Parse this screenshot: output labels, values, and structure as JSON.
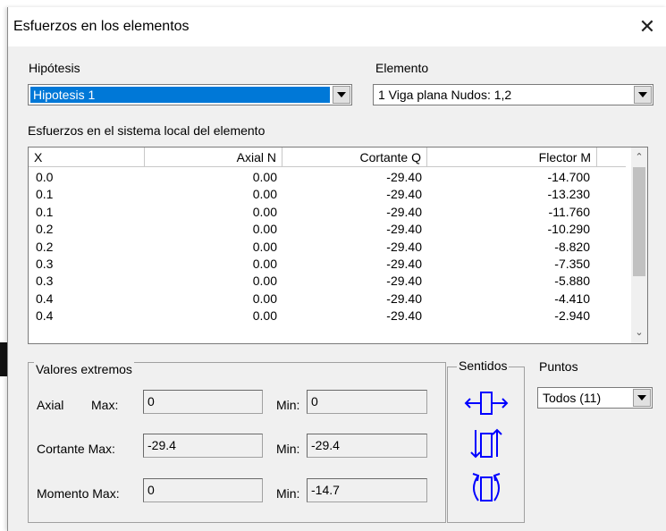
{
  "window": {
    "title": "Esfuerzos en los elementos",
    "close_glyph": "✕"
  },
  "hipotesis": {
    "label": "Hipótesis",
    "value": "Hipotesis 1"
  },
  "elemento": {
    "label": "Elemento",
    "value": "1  Viga plana  Nudos: 1,2"
  },
  "table_caption": "Esfuerzos en el sistema local del elemento",
  "table": {
    "headers": [
      "X",
      "Axial N",
      "Cortante Q",
      "Flector M"
    ],
    "rows": [
      [
        "0.0",
        "0.00",
        "-29.40",
        "-14.700"
      ],
      [
        "0.1",
        "0.00",
        "-29.40",
        "-13.230"
      ],
      [
        "0.1",
        "0.00",
        "-29.40",
        "-11.760"
      ],
      [
        "0.2",
        "0.00",
        "-29.40",
        "-10.290"
      ],
      [
        "0.2",
        "0.00",
        "-29.40",
        "-8.820"
      ],
      [
        "0.3",
        "0.00",
        "-29.40",
        "-7.350"
      ],
      [
        "0.3",
        "0.00",
        "-29.40",
        "-5.880"
      ],
      [
        "0.4",
        "0.00",
        "-29.40",
        "-4.410"
      ],
      [
        "0.4",
        "0.00",
        "-29.40",
        "-2.940"
      ]
    ]
  },
  "extremos": {
    "title": "Valores extremos",
    "axial_label": "Axial",
    "max_label": "Max:",
    "axial_max": "0",
    "min_label": "Min:",
    "axial_min": "0",
    "cortante_label": "Cortante Max:",
    "cortante_max": "-29.4",
    "cortante_min": "-29.4",
    "momento_label": "Momento Max:",
    "momento_max": "0",
    "momento_min": "-14.7"
  },
  "sentidos": {
    "title": "Sentidos",
    "icons": [
      "axial-direction-icon",
      "shear-direction-icon",
      "moment-direction-icon"
    ]
  },
  "puntos": {
    "label": "Puntos",
    "value": "Todos (11)"
  },
  "colors": {
    "selection": "#0078d7",
    "icon_blue": "#0000ff",
    "window_bg": "#f0f0f0"
  }
}
